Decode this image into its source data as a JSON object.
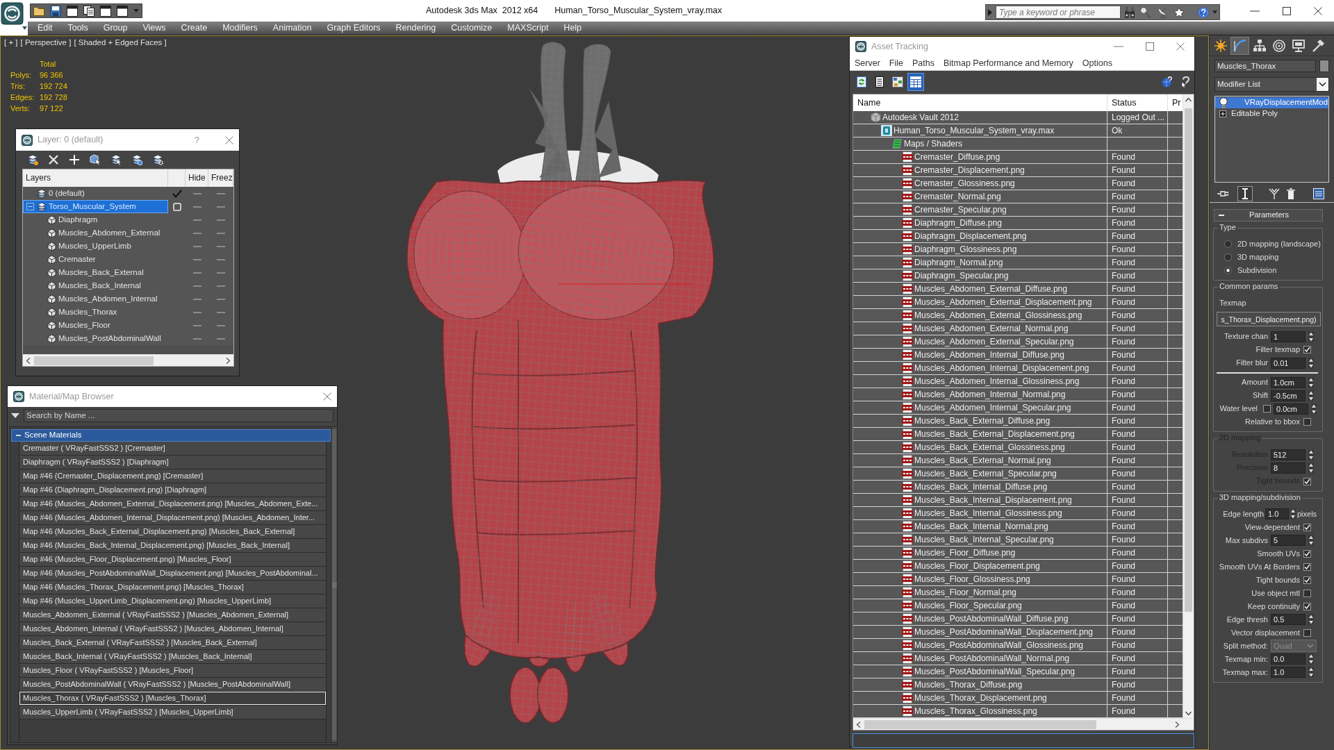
{
  "title_bar": {
    "app_title": "Autodesk 3ds Max  2012 x64",
    "file_title": "Human_Torso_Muscular_System_vray.max",
    "search": {
      "placeholder": "Type a keyword or phrase"
    }
  },
  "menu": [
    "Edit",
    "Tools",
    "Group",
    "Views",
    "Create",
    "Modifiers",
    "Animation",
    "Graph Editors",
    "Rendering",
    "Customize",
    "MAXScript",
    "Help"
  ],
  "viewport": {
    "labels": [
      "[ + ]",
      "[ Perspective ]",
      "[ Shaded + Edged Faces ]"
    ],
    "stats": {
      "heading": "Total",
      "rows": [
        {
          "label": "Polys:",
          "value": "96 366"
        },
        {
          "label": "Tris:",
          "value": "192 724"
        },
        {
          "label": "Edges:",
          "value": "192 728"
        },
        {
          "label": "Verts:",
          "value": "97 122"
        }
      ]
    }
  },
  "layer_window": {
    "title": "Layer: 0 (default)",
    "help": "?",
    "columns": [
      "Layers",
      "Hide",
      "Freez"
    ],
    "layers": [
      {
        "kind": "layer",
        "name": "0 (default)",
        "current": true,
        "selected": false
      },
      {
        "kind": "layer",
        "name": "Torso_Muscular_System",
        "current": false,
        "selected": true,
        "expanded": true,
        "children": [
          {
            "kind": "object",
            "name": "Diaphragm",
            "selected": false
          },
          {
            "kind": "object",
            "name": "Muscles_Abdomen_External",
            "selected": false
          },
          {
            "kind": "object",
            "name": "Muscles_UpperLimb",
            "selected": false
          },
          {
            "kind": "object",
            "name": "Cremaster",
            "selected": false
          },
          {
            "kind": "object",
            "name": "Muscles_Back_External",
            "selected": false
          },
          {
            "kind": "object",
            "name": "Muscles_Back_Internal",
            "selected": false
          },
          {
            "kind": "object",
            "name": "Muscles_Abdomen_Internal",
            "selected": false
          },
          {
            "kind": "object",
            "name": "Muscles_Thorax",
            "selected": false
          },
          {
            "kind": "object",
            "name": "Muscles_Floor",
            "selected": false
          },
          {
            "kind": "object",
            "name": "Muscles_PostAbdominalWall",
            "selected": false
          }
        ]
      }
    ]
  },
  "material_browser": {
    "title": "Material/Map Browser",
    "search": {
      "placeholder": "Search by Name ..."
    },
    "group": {
      "name": "Scene Materials",
      "expanded": true,
      "items": [
        {
          "label": "Cremaster ( VRayFastSSS2 ) [Cremaster]",
          "selected": false
        },
        {
          "label": "Diaphragm ( VRayFastSSS2 ) [Diaphragm]",
          "selected": false
        },
        {
          "label": "Map #46 (Cremaster_Displacement.png) [Cremaster]",
          "selected": false
        },
        {
          "label": "Map #46 (Diaphragm_Displacement.png) [Diaphragm]",
          "selected": false
        },
        {
          "label": "Map #46 (Muscles_Abdomen_External_Displacement.png) [Muscles_Abdomen_Exte...",
          "selected": false
        },
        {
          "label": "Map #46 (Muscles_Abdomen_Internal_Displacement.png) [Muscles_Abdomen_Inter...",
          "selected": false
        },
        {
          "label": "Map #46 (Muscles_Back_External_Displacement.png) [Muscles_Back_External]",
          "selected": false
        },
        {
          "label": "Map #46 (Muscles_Back_Internal_Displacement.png) [Muscles_Back_Internal]",
          "selected": false
        },
        {
          "label": "Map #46 (Muscles_Floor_Displacement.png) [Muscles_Floor]",
          "selected": false
        },
        {
          "label": "Map #46 (Muscles_PostAbdominalWall_Displacement.png) [Muscles_PostAbdominal...",
          "selected": false
        },
        {
          "label": "Map #46 (Muscles_Thorax_Displacement.png) [Muscles_Thorax]",
          "selected": false
        },
        {
          "label": "Map #46 (Muscles_UpperLimb_Displacement.png) [Muscles_UpperLimb]",
          "selected": false
        },
        {
          "label": "Muscles_Abdomen_External ( VRayFastSSS2 ) [Muscles_Abdomen_External]",
          "selected": false
        },
        {
          "label": "Muscles_Abdomen_Internal ( VRayFastSSS2 ) [Muscles_Abdomen_Internal]",
          "selected": false
        },
        {
          "label": "Muscles_Back_External ( VRayFastSSS2 ) [Muscles_Back_External]",
          "selected": false
        },
        {
          "label": "Muscles_Back_Internal ( VRayFastSSS2 ) [Muscles_Back_Internal]",
          "selected": false
        },
        {
          "label": "Muscles_Floor ( VRayFastSSS2 ) [Muscles_Floor]",
          "selected": false
        },
        {
          "label": "Muscles_PostAbdominalWall ( VRayFastSSS2 ) [Muscles_PostAbdominalWall]",
          "selected": false
        },
        {
          "label": "Muscles_Thorax ( VRayFastSSS2 ) [Muscles_Thorax]",
          "selected": true
        },
        {
          "label": "Muscles_UpperLimb ( VRayFastSSS2 ) [Muscles_UpperLimb]",
          "selected": false
        }
      ]
    }
  },
  "asset_tracking": {
    "title": "Asset Tracking",
    "menu": [
      "Server",
      "File",
      "Paths",
      "Bitmap Performance and Memory",
      "Options"
    ],
    "toolbar": [
      {
        "kind": "refresh",
        "selected": false
      },
      {
        "kind": "list",
        "selected": false
      },
      {
        "kind": "thumbnails",
        "selected": false
      },
      {
        "kind": "table",
        "selected": true
      }
    ],
    "columns": [
      "Name",
      "Status",
      "Pr"
    ],
    "rows": [
      {
        "kind": "vault",
        "name": "Autodesk Vault 2012",
        "status": "Logged Out ...",
        "selected": false,
        "children": [
          {
            "kind": "max",
            "name": "Human_Torso_Muscular_System_vray.max",
            "status": "Ok",
            "selected": false,
            "children": [
              {
                "kind": "folder",
                "name": "Maps / Shaders",
                "selected": false,
                "children": [
                  {
                    "kind": "png",
                    "name": "Cremaster_Diffuse.png",
                    "status": "Found",
                    "selected": false
                  },
                  {
                    "kind": "png",
                    "name": "Cremaster_Displacement.png",
                    "status": "Found",
                    "selected": false
                  },
                  {
                    "kind": "png",
                    "name": "Cremaster_Glossiness.png",
                    "status": "Found",
                    "selected": false
                  },
                  {
                    "kind": "png",
                    "name": "Cremaster_Normal.png",
                    "status": "Found",
                    "selected": false
                  },
                  {
                    "kind": "png",
                    "name": "Cremaster_Specular.png",
                    "status": "Found",
                    "selected": false
                  },
                  {
                    "kind": "png",
                    "name": "Diaphragm_Diffuse.png",
                    "status": "Found",
                    "selected": false
                  },
                  {
                    "kind": "png",
                    "name": "Diaphragm_Displacement.png",
                    "status": "Found",
                    "selected": false
                  },
                  {
                    "kind": "png",
                    "name": "Diaphragm_Glossiness.png",
                    "status": "Found",
                    "selected": false
                  },
                  {
                    "kind": "png",
                    "name": "Diaphragm_Normal.png",
                    "status": "Found",
                    "selected": false
                  },
                  {
                    "kind": "png",
                    "name": "Diaphragm_Specular.png",
                    "status": "Found",
                    "selected": false
                  },
                  {
                    "kind": "png",
                    "name": "Muscles_Abdomen_External_Diffuse.png",
                    "status": "Found",
                    "selected": false
                  },
                  {
                    "kind": "png",
                    "name": "Muscles_Abdomen_External_Displacement.png",
                    "status": "Found",
                    "selected": false
                  },
                  {
                    "kind": "png",
                    "name": "Muscles_Abdomen_External_Glossiness.png",
                    "status": "Found",
                    "selected": false
                  },
                  {
                    "kind": "png",
                    "name": "Muscles_Abdomen_External_Normal.png",
                    "status": "Found",
                    "selected": false
                  },
                  {
                    "kind": "png",
                    "name": "Muscles_Abdomen_External_Specular.png",
                    "status": "Found",
                    "selected": false
                  },
                  {
                    "kind": "png",
                    "name": "Muscles_Abdomen_Internal_Diffuse.png",
                    "status": "Found",
                    "selected": false
                  },
                  {
                    "kind": "png",
                    "name": "Muscles_Abdomen_Internal_Displacement.png",
                    "status": "Found",
                    "selected": false
                  },
                  {
                    "kind": "png",
                    "name": "Muscles_Abdomen_Internal_Glossiness.png",
                    "status": "Found",
                    "selected": false
                  },
                  {
                    "kind": "png",
                    "name": "Muscles_Abdomen_Internal_Normal.png",
                    "status": "Found",
                    "selected": false
                  },
                  {
                    "kind": "png",
                    "name": "Muscles_Abdomen_Internal_Specular.png",
                    "status": "Found",
                    "selected": false
                  },
                  {
                    "kind": "png",
                    "name": "Muscles_Back_External_Diffuse.png",
                    "status": "Found",
                    "selected": false
                  },
                  {
                    "kind": "png",
                    "name": "Muscles_Back_External_Displacement.png",
                    "status": "Found",
                    "selected": false
                  },
                  {
                    "kind": "png",
                    "name": "Muscles_Back_External_Glossiness.png",
                    "status": "Found",
                    "selected": false
                  },
                  {
                    "kind": "png",
                    "name": "Muscles_Back_External_Normal.png",
                    "status": "Found",
                    "selected": false
                  },
                  {
                    "kind": "png",
                    "name": "Muscles_Back_External_Specular.png",
                    "status": "Found",
                    "selected": false
                  },
                  {
                    "kind": "png",
                    "name": "Muscles_Back_Internal_Diffuse.png",
                    "status": "Found",
                    "selected": false
                  },
                  {
                    "kind": "png",
                    "name": "Muscles_Back_Internal_Displacement.png",
                    "status": "Found",
                    "selected": false
                  },
                  {
                    "kind": "png",
                    "name": "Muscles_Back_Internal_Glossiness.png",
                    "status": "Found",
                    "selected": false
                  },
                  {
                    "kind": "png",
                    "name": "Muscles_Back_Internal_Normal.png",
                    "status": "Found",
                    "selected": false
                  },
                  {
                    "kind": "png",
                    "name": "Muscles_Back_Internal_Specular.png",
                    "status": "Found",
                    "selected": false
                  },
                  {
                    "kind": "png",
                    "name": "Muscles_Floor_Diffuse.png",
                    "status": "Found",
                    "selected": false
                  },
                  {
                    "kind": "png",
                    "name": "Muscles_Floor_Displacement.png",
                    "status": "Found",
                    "selected": false
                  },
                  {
                    "kind": "png",
                    "name": "Muscles_Floor_Glossiness.png",
                    "status": "Found",
                    "selected": false
                  },
                  {
                    "kind": "png",
                    "name": "Muscles_Floor_Normal.png",
                    "status": "Found",
                    "selected": false
                  },
                  {
                    "kind": "png",
                    "name": "Muscles_Floor_Specular.png",
                    "status": "Found",
                    "selected": false
                  },
                  {
                    "kind": "png",
                    "name": "Muscles_PostAbdominalWall_Diffuse.png",
                    "status": "Found",
                    "selected": false
                  },
                  {
                    "kind": "png",
                    "name": "Muscles_PostAbdominalWall_Displacement.png",
                    "status": "Found",
                    "selected": false
                  },
                  {
                    "kind": "png",
                    "name": "Muscles_PostAbdominalWall_Glossiness.png",
                    "status": "Found",
                    "selected": false
                  },
                  {
                    "kind": "png",
                    "name": "Muscles_PostAbdominalWall_Normal.png",
                    "status": "Found",
                    "selected": false
                  },
                  {
                    "kind": "png",
                    "name": "Muscles_PostAbdominalWall_Specular.png",
                    "status": "Found",
                    "selected": false
                  },
                  {
                    "kind": "png",
                    "name": "Muscles_Thorax_Diffuse.png",
                    "status": "Found",
                    "selected": false
                  },
                  {
                    "kind": "png",
                    "name": "Muscles_Thorax_Displacement.png",
                    "status": "Found",
                    "selected": false
                  },
                  {
                    "kind": "png",
                    "name": "Muscles_Thorax_Glossiness.png",
                    "status": "Found",
                    "selected": false
                  }
                ]
              }
            ]
          }
        ]
      }
    ]
  },
  "command_panel": {
    "tabs": [
      {
        "kind": "create",
        "selected": false
      },
      {
        "kind": "modify",
        "selected": true
      },
      {
        "kind": "hierarchy",
        "selected": false
      },
      {
        "kind": "motion",
        "selected": false
      },
      {
        "kind": "display",
        "selected": false
      },
      {
        "kind": "utilities",
        "selected": false
      }
    ],
    "object_name": "Muscles_Thorax",
    "modifier_list": "Modifier List",
    "stack": [
      {
        "kind": "modifier",
        "name": "VRayDisplacementMod",
        "enabled": true,
        "selected": true
      },
      {
        "kind": "object",
        "name": "Editable Poly",
        "expanded": false,
        "selected": false
      }
    ],
    "stack_tools": [
      {
        "kind": "pin",
        "on": false
      },
      {
        "kind": "end_result",
        "on": true
      },
      {
        "kind": "make_unique",
        "on": false
      },
      {
        "kind": "remove",
        "on": false
      },
      {
        "kind": "configure",
        "on": false
      }
    ],
    "rollout": {
      "title": "Parameters",
      "expanded": true,
      "groups": [
        {
          "title": "Type",
          "disabled": false,
          "controls": [
            {
              "kind": "radio",
              "label": "2D mapping (landscape)",
              "checked": false
            },
            {
              "kind": "radio",
              "label": "3D mapping",
              "checked": false
            },
            {
              "kind": "radio",
              "label": "Subdivision",
              "checked": true
            }
          ]
        },
        {
          "title": "Common params",
          "disabled": false,
          "controls": [
            {
              "kind": "label",
              "label": "Texmap"
            },
            {
              "kind": "map_button",
              "value": "s_Thorax_Displacement.png)"
            },
            {
              "kind": "spinner",
              "label": "Texture chan",
              "value": "1"
            },
            {
              "kind": "checkbox",
              "label": "Filter texmap",
              "checked": true
            },
            {
              "kind": "spinner",
              "label": "Filter blur",
              "value": "0.01"
            },
            {
              "kind": "separator"
            },
            {
              "kind": "spinner",
              "label": "Amount",
              "value": "1.0cm"
            },
            {
              "kind": "spinner",
              "label": "Shift",
              "value": "-0.5cm"
            },
            {
              "kind": "check_spinner",
              "label": "Water level",
              "checked": false,
              "value": "0.0cm"
            },
            {
              "kind": "checkbox",
              "label": "Relative to bbox",
              "checked": false
            }
          ]
        },
        {
          "title": "2D mapping",
          "disabled": true,
          "controls": [
            {
              "kind": "spinner",
              "label": "Resolution",
              "value": "512"
            },
            {
              "kind": "spinner",
              "label": "Precision",
              "value": "8"
            },
            {
              "kind": "checkbox",
              "label": "Tight bounds",
              "checked": true
            }
          ]
        },
        {
          "title": "3D mapping/subdivision",
          "disabled": false,
          "controls": [
            {
              "kind": "spinner",
              "label": "Edge length",
              "value": "1.0",
              "unit": "pixels"
            },
            {
              "kind": "checkbox",
              "label": "View-dependent",
              "checked": true
            },
            {
              "kind": "spinner",
              "label": "Max subdivs",
              "value": "5"
            },
            {
              "kind": "checkbox",
              "label": "Smooth UVs",
              "checked": true
            },
            {
              "kind": "checkbox",
              "label": "Smooth UVs At Borders",
              "checked": true
            },
            {
              "kind": "checkbox",
              "label": "Tight bounds",
              "checked": true
            },
            {
              "kind": "checkbox",
              "label": "Use object mtl",
              "checked": false
            },
            {
              "kind": "checkbox",
              "label": "Keep continuity",
              "checked": true
            },
            {
              "kind": "spinner",
              "label": "Edge thresh",
              "value": "0.5"
            },
            {
              "kind": "checkbox",
              "label": "Vector displacement",
              "checked": false
            },
            {
              "kind": "dropdown",
              "label": "Split method:",
              "value": "Quad",
              "disabled": true
            },
            {
              "kind": "spinner",
              "label": "Texmap min:",
              "value": "0.0"
            },
            {
              "kind": "spinner",
              "label": "Texmap max:",
              "value": "1.0"
            }
          ]
        }
      ]
    }
  }
}
